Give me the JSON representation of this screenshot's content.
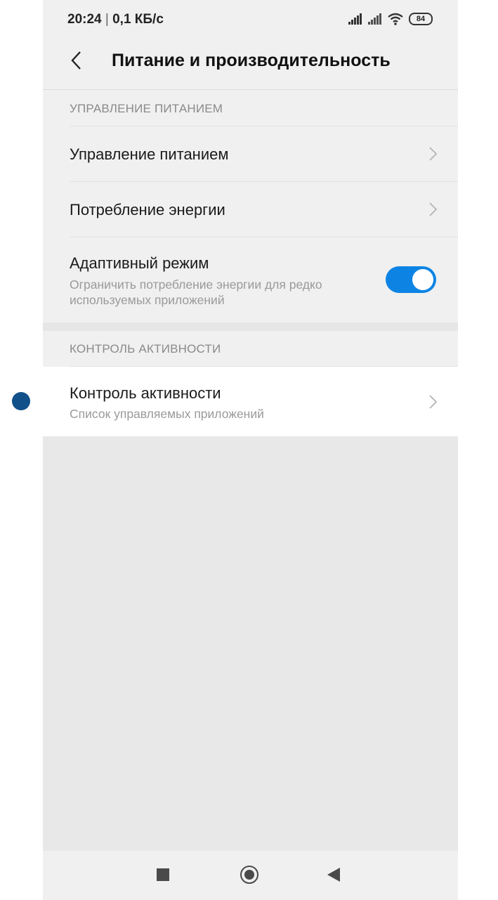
{
  "status_bar": {
    "time": "20:24",
    "separator": " | ",
    "network_speed": "0,1 КБ/с",
    "battery_level": "84"
  },
  "header": {
    "title": "Питание и производительность"
  },
  "sections": [
    {
      "heading": "УПРАВЛЕНИЕ ПИТАНИЕМ",
      "items": [
        {
          "title": "Управление питанием"
        },
        {
          "title": "Потребление энергии"
        },
        {
          "title": "Адаптивный режим",
          "subtitle": "Ограничить потребление энергии для редко используемых приложений",
          "toggle_on": true
        }
      ]
    },
    {
      "heading": "КОНТРОЛЬ АКТИВНОСТИ",
      "items": [
        {
          "title": "Контроль активности",
          "subtitle": "Список управляемых приложений"
        }
      ]
    }
  ],
  "colors": {
    "accent": "#0d84e4",
    "background": "#f0f0f0",
    "touch_indicator": "#12508a"
  },
  "icons": {
    "back": "chevron-left-icon",
    "item_arrow": "chevron-right-icon",
    "nav_recents": "square-icon",
    "nav_home": "circle-icon",
    "nav_back": "triangle-back-icon"
  }
}
